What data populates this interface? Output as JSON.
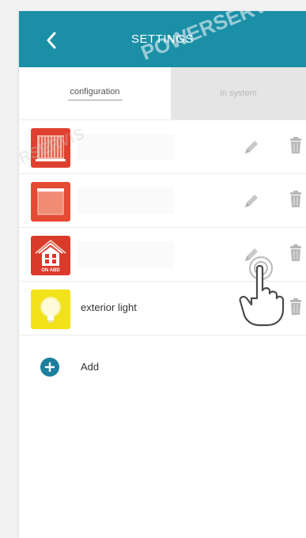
{
  "header": {
    "title": "SETTINGS",
    "background": "#1b8fa6"
  },
  "tabs": [
    {
      "label": "configuration",
      "active": true
    },
    {
      "label": "in system",
      "active": false
    }
  ],
  "devices": [
    {
      "icon": "shutter-icon",
      "name": "",
      "color": "#e0402f"
    },
    {
      "icon": "blind-icon",
      "name": "",
      "color": "#e54a33"
    },
    {
      "icon": "house-icon",
      "name": "",
      "color": "#d93a2a"
    },
    {
      "icon": "light-bulb-icon",
      "name": "exterior light",
      "color": "#f2e21a"
    }
  ],
  "add": {
    "label": "Add"
  },
  "icons": {
    "back": "chevron-left-icon",
    "edit": "pencil-icon",
    "delete": "trash-icon",
    "add": "plus-icon",
    "pointer": "hand-pointer-icon"
  },
  "house_badge": "ON ABD",
  "watermark": "POWERSERVIS"
}
